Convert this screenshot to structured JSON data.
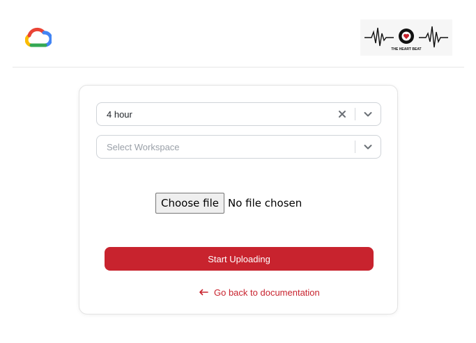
{
  "header": {
    "cloud_logo_icon": "google-cloud-icon",
    "brand_logo_text": "THE HEART BEAT",
    "brand_accent": "#c8232e"
  },
  "form": {
    "duration": {
      "value": "4 hour",
      "clear_icon": "close-icon",
      "toggle_icon": "chevron-down-icon"
    },
    "workspace": {
      "placeholder": "Select Workspace",
      "toggle_icon": "chevron-down-icon"
    },
    "file": {
      "button_label": "Choose file",
      "status": "No file chosen"
    },
    "upload_button_label": "Start Uploading",
    "back_link_label": "Go back to documentation"
  },
  "colors": {
    "primary": "#c8232e",
    "border": "#cfd3d8",
    "placeholder": "#9aa0a8"
  }
}
